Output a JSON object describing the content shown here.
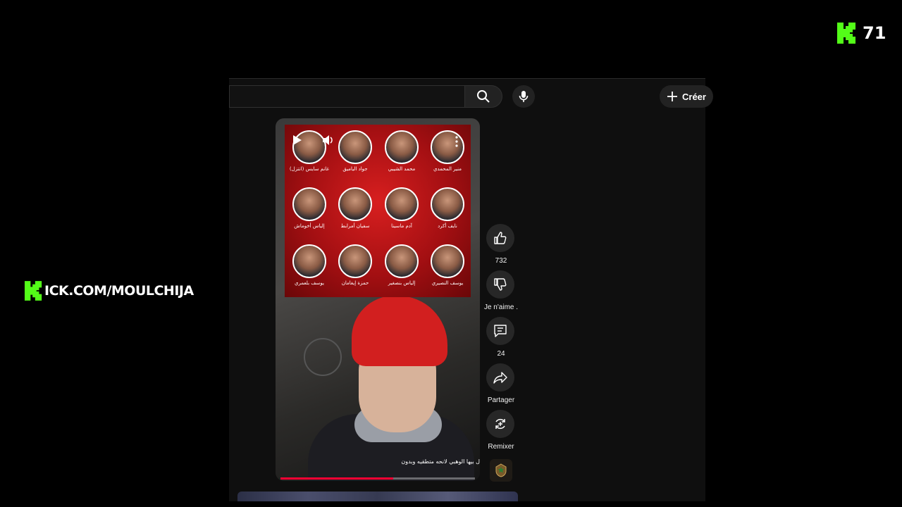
{
  "overlay": {
    "kick_count": "71",
    "kick_url": "ICK.COM/MOULCHIJA",
    "brand_color": "#53fc18"
  },
  "topbar": {
    "create_label": "Créer",
    "icons": [
      "search-icon",
      "mic-icon",
      "plus-icon"
    ]
  },
  "video": {
    "players": [
      {
        "name": "منير المحمدي"
      },
      {
        "name": "محمد الشيبي"
      },
      {
        "name": "جواد الياميق"
      },
      {
        "name": "غانم سايس (انتزل)"
      },
      {
        "name": "نايف أكرد"
      },
      {
        "name": "آدم ماسينا"
      },
      {
        "name": "سفيان أمرابط"
      },
      {
        "name": "إلياس أخوماش"
      },
      {
        "name": "يوسف النصيري"
      },
      {
        "name": "إلياس بنصغير"
      },
      {
        "name": "حمزة إيغامان"
      },
      {
        "name": "يوسف بلعمري"
      }
    ],
    "caption": "ل بيها الوهبي لانحه متطقيه وبدون",
    "progress": 0.58,
    "accent": "#ff0033"
  },
  "actions": {
    "likes": "732",
    "dislike_label": "Je n'aime .",
    "comments": "24",
    "share_label": "Partager",
    "remix_label": "Remixer"
  }
}
